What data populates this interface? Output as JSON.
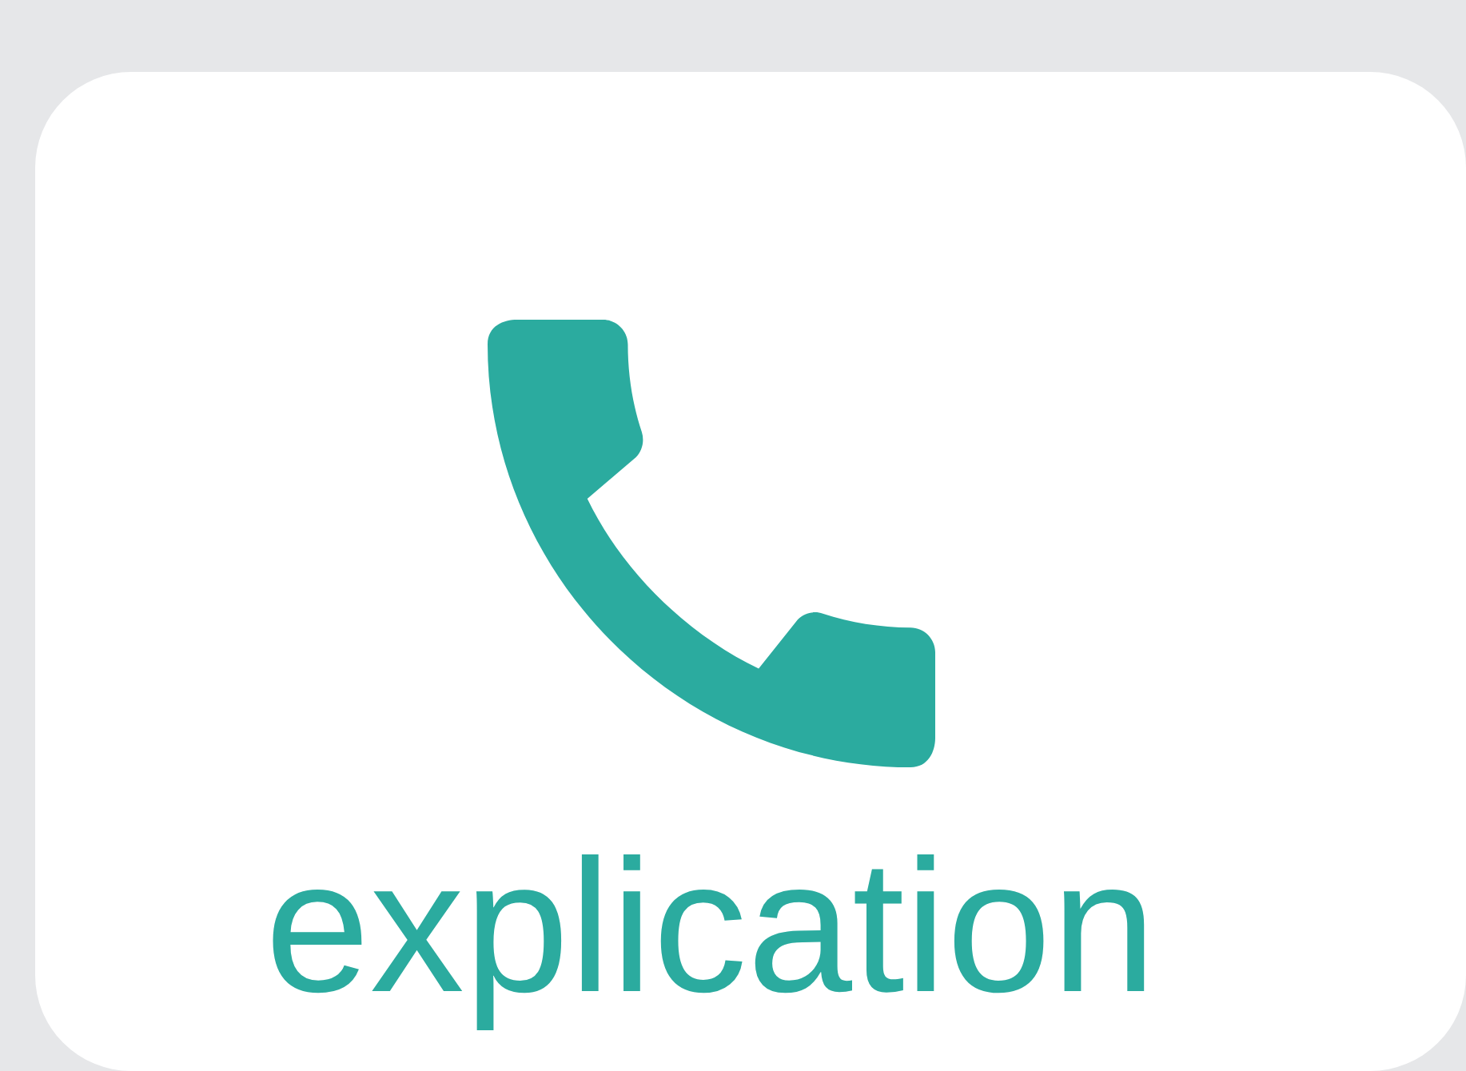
{
  "card": {
    "label": "explication"
  }
}
